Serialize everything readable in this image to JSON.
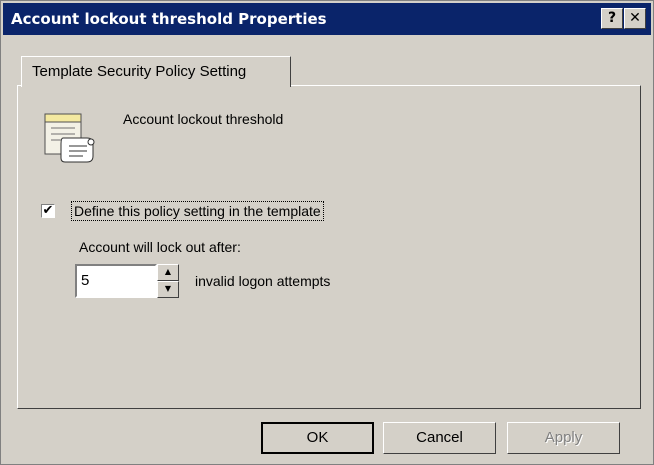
{
  "window": {
    "title": "Account lockout threshold Properties",
    "help_button": "?",
    "close_button": "✕"
  },
  "tab": {
    "label": "Template Security Policy Setting"
  },
  "policy": {
    "name": "Account lockout threshold",
    "icon": "policy-scroll-icon"
  },
  "define_setting": {
    "checked": true,
    "check_glyph": "✔",
    "label": "Define this policy setting in the template"
  },
  "lockout": {
    "label": "Account will lock out after:",
    "value": "5",
    "suffix": "invalid logon attempts",
    "up_glyph": "▲",
    "down_glyph": "▼"
  },
  "buttons": {
    "ok": "OK",
    "cancel": "Cancel",
    "apply": "Apply"
  }
}
